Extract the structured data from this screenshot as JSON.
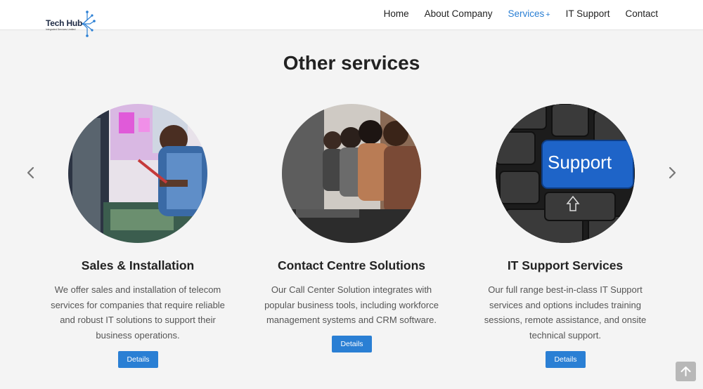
{
  "header": {
    "logo": {
      "name": "Tech Hub",
      "tagline": "Integrated Services Limited"
    },
    "nav": [
      {
        "label": "Home",
        "active": false
      },
      {
        "label": "About Company",
        "active": false
      },
      {
        "label": "Services",
        "active": true,
        "suffix": "+"
      },
      {
        "label": "IT Support",
        "active": false
      },
      {
        "label": "Contact",
        "active": false
      }
    ]
  },
  "section": {
    "title": "Other services"
  },
  "carousel": {
    "prev_icon": "chevron-left-icon",
    "next_icon": "chevron-right-icon"
  },
  "cards": [
    {
      "title": "Sales & Installation",
      "description": "We offer sales and installation of telecom services for companies that require reliable and robust IT solutions to support their business operations.",
      "button": "Details",
      "image": "technician-soldering-circuit-board-photo"
    },
    {
      "title": "Contact Centre Solutions",
      "description": "Our Call Center Solution integrates with popular business tools, including workforce management systems and CRM software.",
      "button": "Details",
      "image": "call-center-agents-with-headsets-photo"
    },
    {
      "title": "IT Support Services",
      "description": "Our full range best-in-class IT Support services and options includes training sessions, remote assistance, and onsite technical support.",
      "button": "Details",
      "image": "keyboard-support-key-photo",
      "key_text": "Support"
    }
  ],
  "scroll_top": {
    "icon": "arrow-up-icon"
  },
  "colors": {
    "accent": "#2a7fd4",
    "background": "#f4f4f4",
    "header": "#ffffff",
    "scroll_top": "#b8b8b8"
  }
}
